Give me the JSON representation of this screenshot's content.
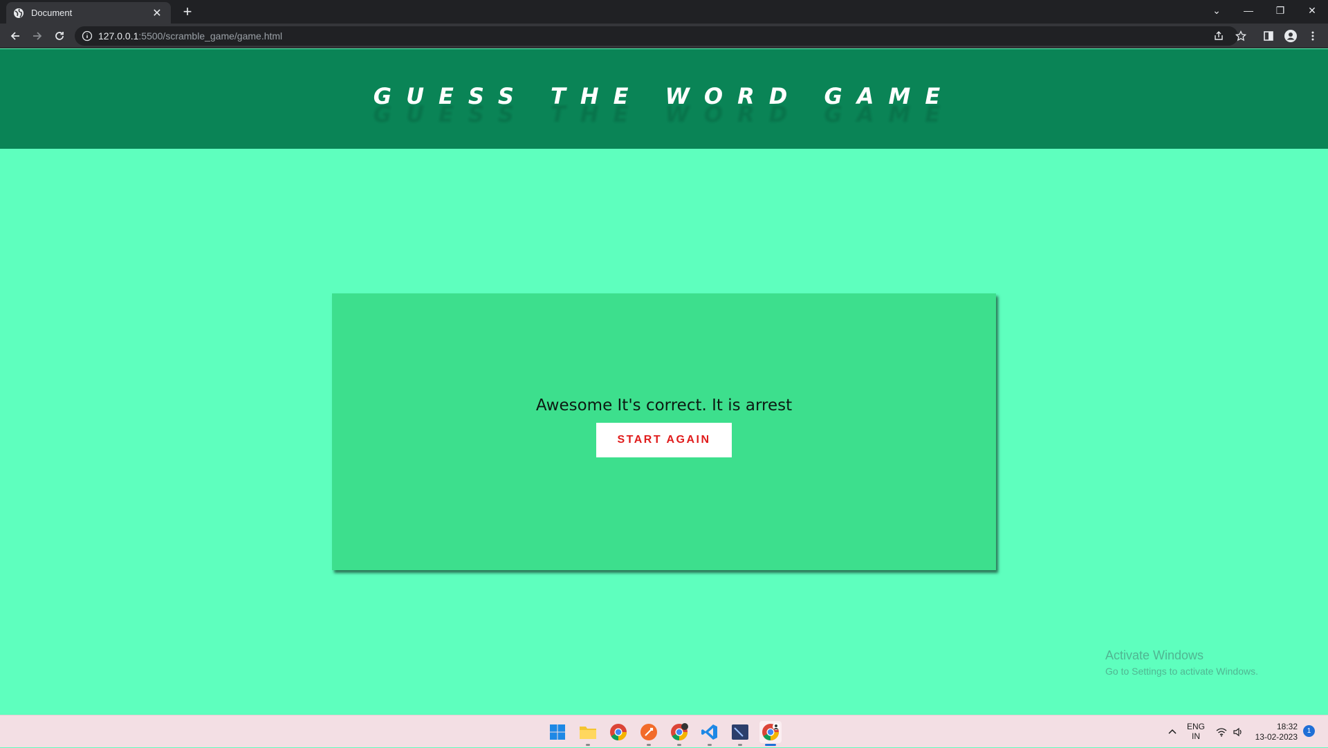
{
  "browser": {
    "tab_title": "Document",
    "tab_close": "✕",
    "new_tab": "+",
    "url_host": "127.0.0.1",
    "url_path": ":5500/scramble_game/game.html",
    "window_controls": {
      "dropdown": "⌄",
      "minimize": "—",
      "restore": "❐",
      "close": "✕"
    }
  },
  "page": {
    "title": "GUESS THE WORD GAME",
    "message": "Awesome It's correct. It is arrest",
    "start_button": "START AGAIN"
  },
  "watermark": {
    "line1": "Activate Windows",
    "line2": "Go to Settings to activate Windows."
  },
  "taskbar": {
    "lang_line1": "ENG",
    "lang_line2": "IN",
    "time": "18:32",
    "date": "13-02-2023",
    "notification_count": "1",
    "apps": [
      "start-icon",
      "file-explorer-icon",
      "chrome-icon",
      "brave-icon",
      "chrome-dev-icon",
      "vscode-icon",
      "terminal-icon",
      "chrome-profile-icon"
    ]
  },
  "colors": {
    "page_bg": "#5effbe",
    "header_bg": "#0a8456",
    "card_bg": "#3ddf8d",
    "button_text": "#e01b1b"
  }
}
